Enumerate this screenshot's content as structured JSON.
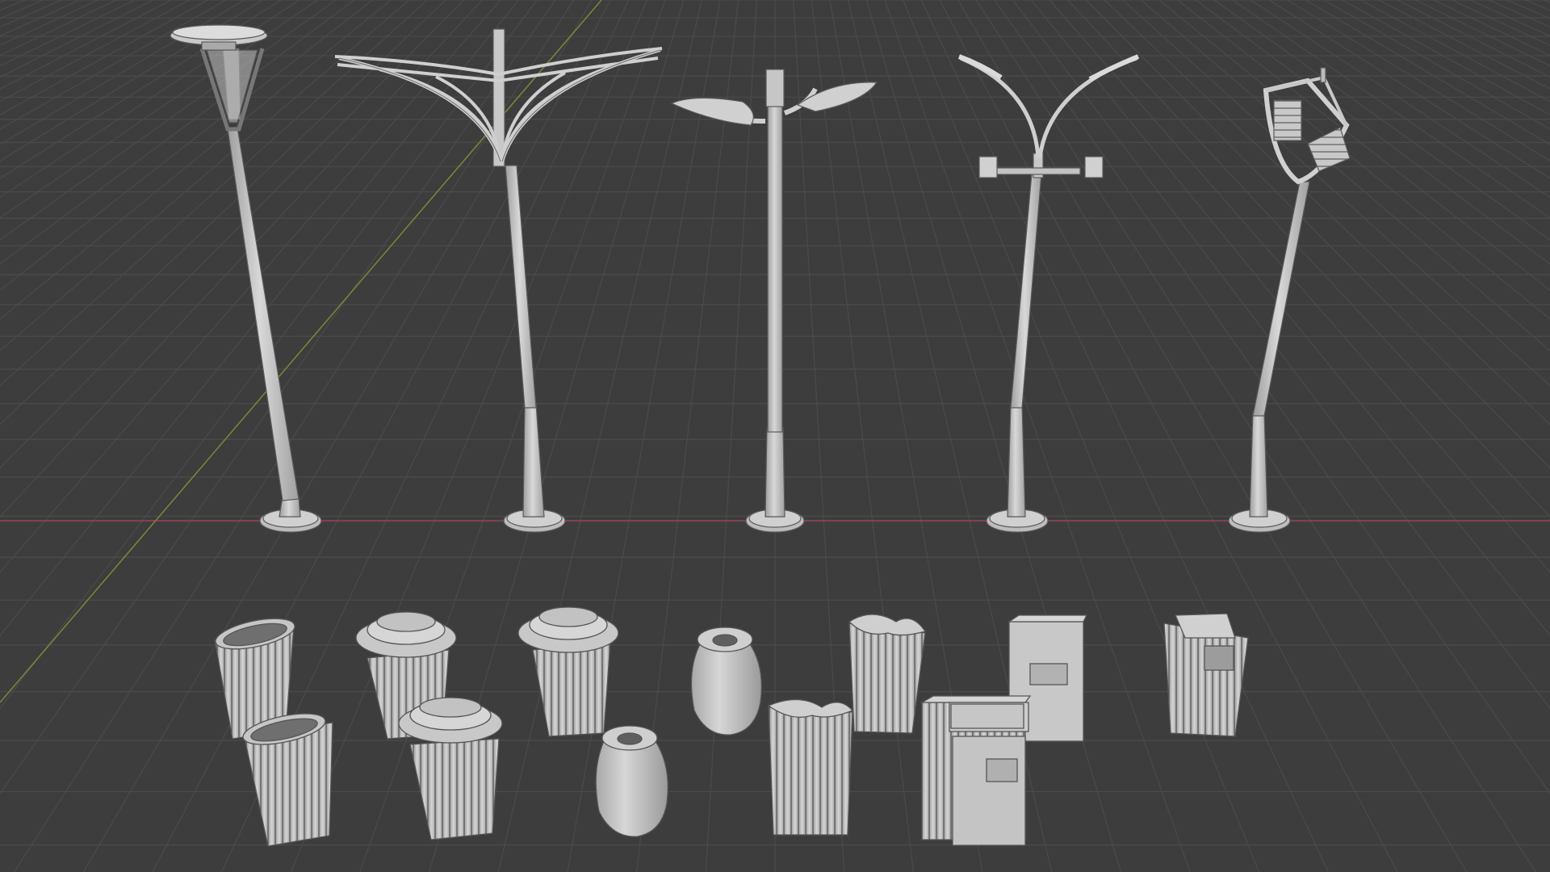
{
  "viewport": {
    "background": "#3d3d3d",
    "grid_color": "#4a4a4a",
    "x_axis_color": "#9a4352",
    "y_axis_color": "#758a3a",
    "model_fill": "#cdcdcd",
    "model_shade": "#a6a6a6",
    "model_edge": "#5a5a5a"
  },
  "scene": {
    "lamps": [
      {
        "name": "lamp-disc-cone"
      },
      {
        "name": "lamp-petal-frame"
      },
      {
        "name": "lamp-double-leaf"
      },
      {
        "name": "lamp-curved-arms"
      },
      {
        "name": "lamp-boat-cage"
      }
    ],
    "bins": [
      {
        "name": "bin-slatted-open"
      },
      {
        "name": "bin-capped-slatted"
      },
      {
        "name": "bin-vase"
      },
      {
        "name": "bin-split-top"
      },
      {
        "name": "bin-box-kiosk"
      },
      {
        "name": "bin-box-slatted"
      }
    ]
  }
}
